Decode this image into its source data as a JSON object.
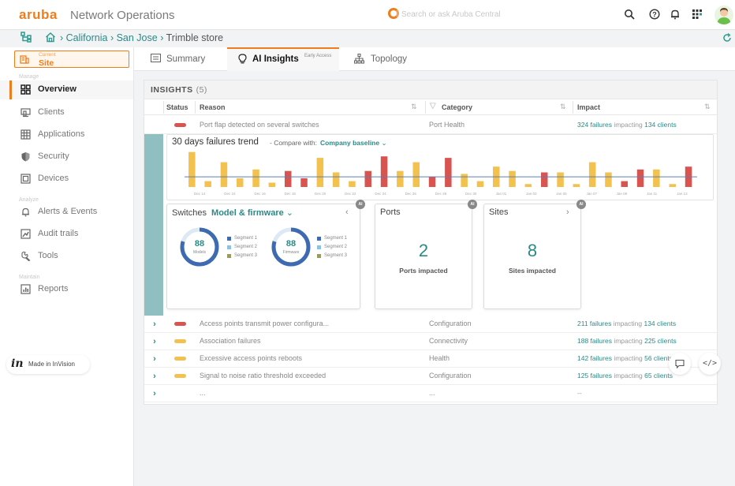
{
  "header": {
    "brand": "aruba",
    "app_title": "Network Operations",
    "search_placeholder": "Search or ask Aruba Central"
  },
  "breadcrumb": {
    "region": "California",
    "city": "San Jose",
    "site": "Trimble store"
  },
  "sidebar": {
    "context_label": "Current",
    "context_value": "Site",
    "section_manage": "Manage",
    "section_analyze": "Analyze",
    "section_maintain": "Maintain",
    "items": [
      {
        "label": "Overview",
        "icon": "grid-icon"
      },
      {
        "label": "Clients",
        "icon": "clients-icon"
      },
      {
        "label": "Applications",
        "icon": "applications-icon"
      },
      {
        "label": "Security",
        "icon": "shield-icon"
      },
      {
        "label": "Devices",
        "icon": "devices-icon"
      },
      {
        "label": "Alerts & Events",
        "icon": "bell-icon"
      },
      {
        "label": "Audit trails",
        "icon": "audit-icon"
      },
      {
        "label": "Tools",
        "icon": "wrench-icon"
      },
      {
        "label": "Reports",
        "icon": "reports-icon"
      }
    ],
    "invision_label": "Made in InVision"
  },
  "tabs": [
    {
      "label": "Summary"
    },
    {
      "label": "AI Insights",
      "badge": "Early Access"
    },
    {
      "label": "Topology"
    }
  ],
  "insights": {
    "title": "INSIGHTS",
    "count": "(5)",
    "columns": [
      "Status",
      "Reason",
      "Category",
      "Impact"
    ],
    "rows": [
      {
        "status_color": "#d9534f",
        "reason": "Port flap detected on several switches",
        "category": "Port Health",
        "impact_failures": "324 failures",
        "impact_mid": "impacting",
        "impact_clients": "134 clients"
      },
      {
        "status_color": "#d9534f",
        "reason": "Access points transmit power configura...",
        "category": "Configuration",
        "impact_failures": "211 failures",
        "impact_mid": "impacting",
        "impact_clients": "134 clients"
      },
      {
        "status_color": "#f2c14e",
        "reason": "Association failures",
        "category": "Connectivity",
        "impact_failures": "188 failures",
        "impact_mid": "impacting",
        "impact_clients": "225 clients"
      },
      {
        "status_color": "#f2c14e",
        "reason": "Excessive access points reboots",
        "category": "Health",
        "impact_failures": "142 failures",
        "impact_mid": "impacting",
        "impact_clients": "56 clients"
      },
      {
        "status_color": "#f2c14e",
        "reason": "Signal to noise ratio threshold exceeded",
        "category": "Configuration",
        "impact_failures": "125 failures",
        "impact_mid": "impacting",
        "impact_clients": "65 clients"
      },
      {
        "status_color": "",
        "reason": "...",
        "category": "...",
        "impact_failures": "--",
        "impact_mid": "",
        "impact_clients": ""
      }
    ]
  },
  "trend": {
    "title": "30 days failures trend",
    "compare_label": "- Compare with:",
    "compare_value": "Company baseline",
    "baseline_color": "#5b7fb9"
  },
  "chart_data": {
    "type": "bar",
    "title": "30 days failures trend",
    "categories": [
      "Dec 14",
      "Dec 15",
      "Dec 16",
      "Dec 17",
      "Dec 18",
      "Dec 19",
      "Dec 20",
      "Dec 21",
      "Dec 22",
      "Dec 23",
      "Dec 24",
      "Dec 25",
      "Dec 26",
      "Dec 27",
      "Dec 28",
      "Dec 29",
      "Dec 30",
      "Dec 31",
      "Jan 01",
      "Jan 02",
      "Jan 03",
      "Jan 04",
      "Jan 05",
      "Jan 06",
      "Jan 07",
      "Jan 08",
      "Jan 09",
      "Jan 10",
      "Jan 11",
      "Jan 12",
      "Jan 13",
      "Jan 14"
    ],
    "tick_labels": [
      "Dec 14",
      "Dec 15",
      "Dec 16",
      "Dec 18",
      "Dec 20",
      "Dec 22",
      "Dec 24",
      "Dec 26",
      "Dec 28",
      "Dec 30",
      "Jan 01",
      "Jan 03",
      "Jan 05",
      "Jan 07",
      "Jan 09",
      "Jan 11",
      "Jan 13"
    ],
    "values": [
      1.2,
      0.2,
      0.85,
      0.3,
      0.6,
      0.15,
      0.55,
      0.3,
      1.0,
      0.5,
      0.2,
      0.55,
      1.05,
      0.55,
      0.85,
      0.35,
      1.0,
      0.45,
      0.2,
      0.7,
      0.55,
      0.1,
      0.5,
      0.5,
      0.1,
      0.85,
      0.5,
      0.2,
      0.6,
      0.6,
      0.1,
      0.7
    ],
    "colors": [
      "#f2c14e",
      "#f2c14e",
      "#f2c14e",
      "#f2c14e",
      "#f2c14e",
      "#f2c14e",
      "#d9534f",
      "#d9534f",
      "#f2c14e",
      "#f2c14e",
      "#f2c14e",
      "#d9534f",
      "#d9534f",
      "#f2c14e",
      "#f2c14e",
      "#d9534f",
      "#d9534f",
      "#f2c14e",
      "#f2c14e",
      "#f2c14e",
      "#f2c14e",
      "#f2c14e",
      "#d9534f",
      "#f2c14e",
      "#f2c14e",
      "#f2c14e",
      "#f2c14e",
      "#d9534f",
      "#d9534f",
      "#f2c14e",
      "#f2c14e",
      "#d9534f"
    ],
    "baseline": 0.35,
    "ylim": [
      0,
      1.3
    ]
  },
  "switches_card": {
    "title": "Switches",
    "subtitle": "Model & firmware",
    "donuts": [
      {
        "value": "88",
        "label": "Models",
        "legend": [
          "Segment 1",
          "Segment 2",
          "Segment 3"
        ],
        "fraction": 0.8
      },
      {
        "value": "88",
        "label": "Firmware",
        "legend": [
          "Segment 1",
          "Segment 2",
          "Segment 3"
        ],
        "fraction": 0.8
      }
    ],
    "legend_colors": [
      "#3d6ab0",
      "#8cc2e6",
      "#9a9a60"
    ]
  },
  "ports_card": {
    "title": "Ports",
    "value": "2",
    "label": "Ports impacted"
  },
  "sites_card": {
    "title": "Sites",
    "value": "8",
    "label": "Sites impacted"
  },
  "ai_badge": "AI"
}
